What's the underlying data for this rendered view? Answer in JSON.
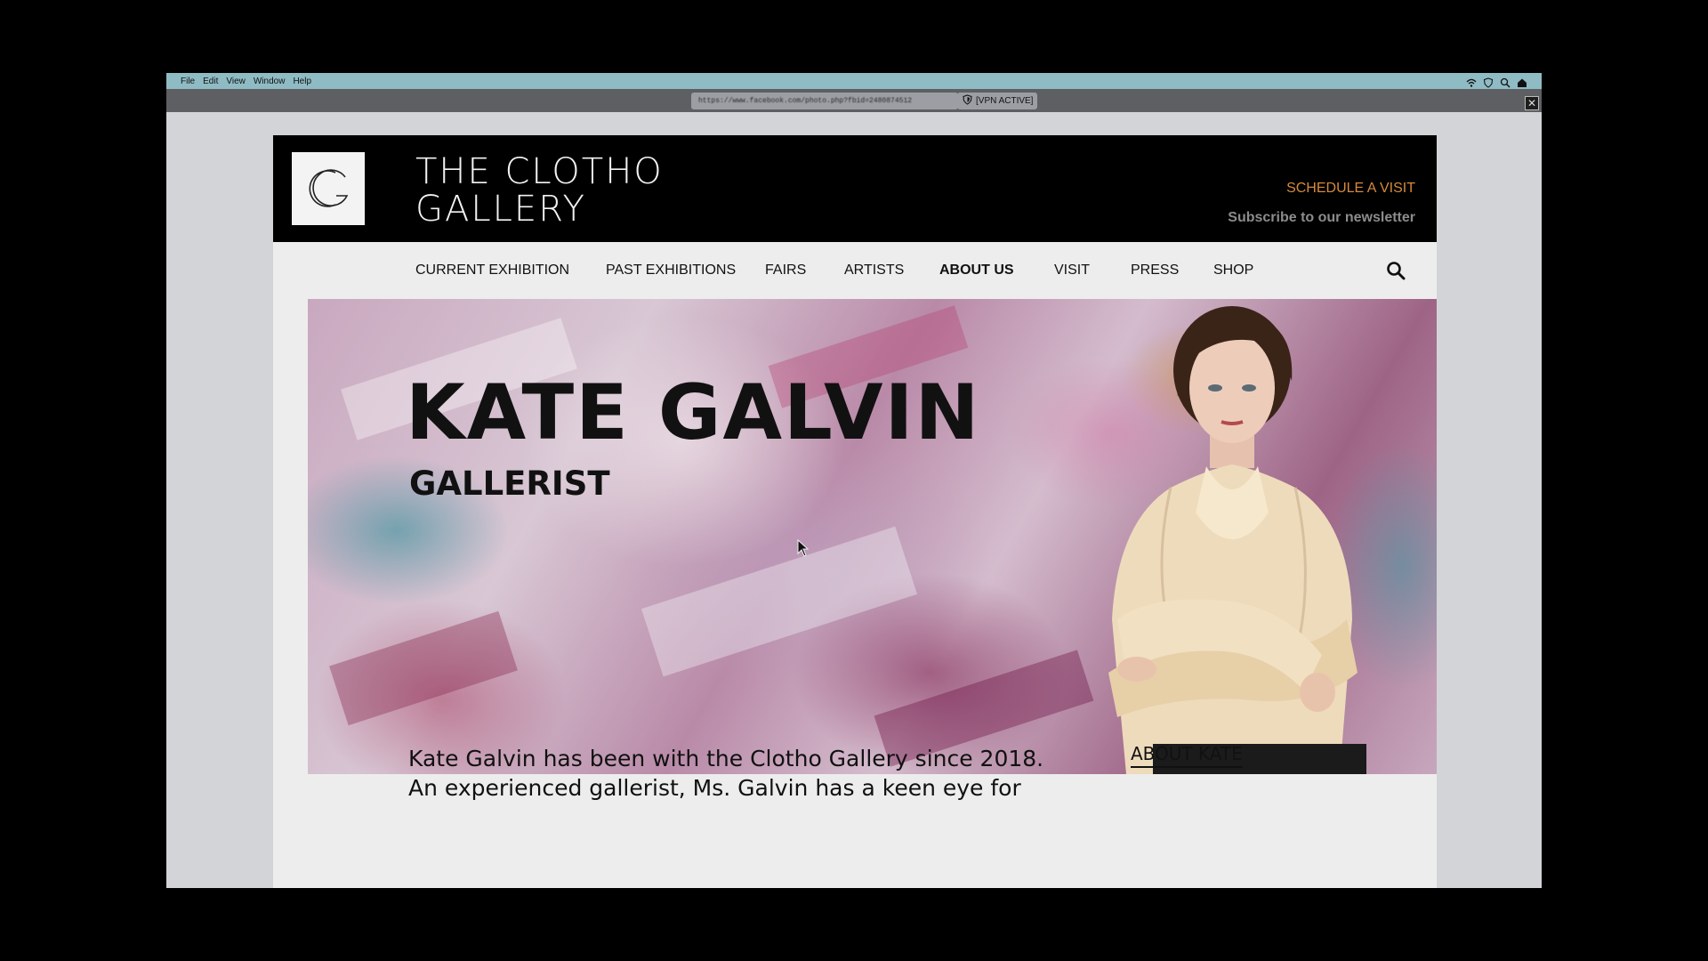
{
  "menubar": {
    "items": [
      "File",
      "Edit",
      "View",
      "Window",
      "Help"
    ]
  },
  "addressbar": {
    "url": "https://www.facebook.com/photo.php?fbid=2480874512",
    "vpn_label": "[VPN ACTIVE]",
    "close_label": "✕"
  },
  "site": {
    "name_line1": "THE CLOTHO",
    "name_line2": "GALLERY",
    "schedule_label": "SCHEDULE A VISIT",
    "newsletter_label": "Subscribe to our newsletter",
    "accent_color": "#d48a3c"
  },
  "nav": {
    "items": [
      {
        "label": "CURRENT EXHIBITION",
        "active": false
      },
      {
        "label": "PAST EXHIBITIONS",
        "active": false
      },
      {
        "label": "FAIRS",
        "active": false
      },
      {
        "label": "ARTISTS",
        "active": false
      },
      {
        "label": "ABOUT US",
        "active": true
      },
      {
        "label": "VISIT",
        "active": false
      },
      {
        "label": "PRESS",
        "active": false
      },
      {
        "label": "SHOP",
        "active": false
      }
    ],
    "search_icon": "search-icon"
  },
  "hero": {
    "name": "KATE GALVIN",
    "title": "GALLERIST"
  },
  "content": {
    "bio": "Kate Galvin has been with the Clotho Gallery since 2018. An experienced gallerist, Ms. Galvin has a keen eye for",
    "sidebar_heading": "ABOUT KATE"
  }
}
